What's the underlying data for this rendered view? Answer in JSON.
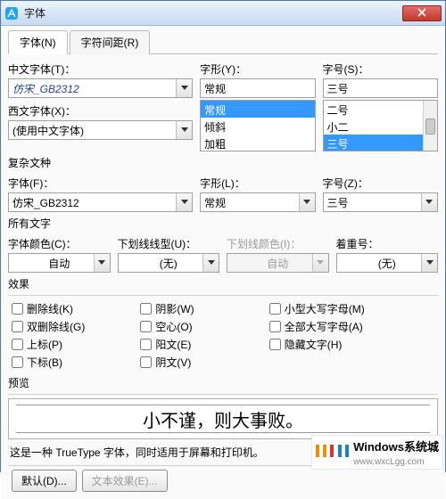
{
  "window": {
    "title": "字体"
  },
  "tabs": {
    "font": "字体(N)",
    "spacing": "字符间距(R)"
  },
  "top": {
    "zh_font_label": "中文字体(T)：",
    "zh_font_value": "仿宋_GB2312",
    "western_font_label": "西文字体(X)：",
    "western_font_value": "(使用中文字体)",
    "style_label": "字形(Y)：",
    "style_value": "常规",
    "style_options": [
      "常规",
      "倾斜",
      "加粗"
    ],
    "size_label": "字号(S)：",
    "size_value": "三号",
    "size_options": [
      "二号",
      "小二",
      "三号"
    ]
  },
  "complex": {
    "title": "复杂文种",
    "font_label": "字体(F)：",
    "font_value": "仿宋_GB2312",
    "style_label": "字形(L)：",
    "style_value": "常规",
    "size_label": "字号(Z)：",
    "size_value": "三号"
  },
  "alltext": {
    "title": "所有文字",
    "color_label": "字体颜色(C)：",
    "color_value": "自动",
    "underline_label": "下划线线型(U)：",
    "underline_value": "(无)",
    "underline_color_label": "下划线颜色(I)：",
    "underline_color_value": "自动",
    "emphasis_label": "着重号：",
    "emphasis_value": "(无)"
  },
  "effects": {
    "title": "效果",
    "items": {
      "strike": "删除线(K)",
      "dstrike": "双删除线(G)",
      "superscript": "上标(P)",
      "subscript": "下标(B)",
      "shadow": "阴影(W)",
      "hollow": "空心(O)",
      "emboss": "阳文(E)",
      "engrave": "阴文(V)",
      "smallcaps": "小型大写字母(M)",
      "allcaps": "全部大写字母(A)",
      "hidden": "隐藏文字(H)"
    }
  },
  "preview": {
    "title": "预览",
    "sample": "小不谨，则大事败。",
    "note": "这是一种 TrueType 字体，同时适用于屏幕和打印机。"
  },
  "buttons": {
    "default": "默认(D)...",
    "text_effects": "文本效果(E)..."
  },
  "watermark": {
    "brand": "Windows系统城",
    "url": "www.wxcLgg.com",
    "bar_colors": [
      "#f08c00",
      "#f08c00",
      "#e03131",
      "#1c7ed6",
      "#1c7ed6"
    ]
  }
}
